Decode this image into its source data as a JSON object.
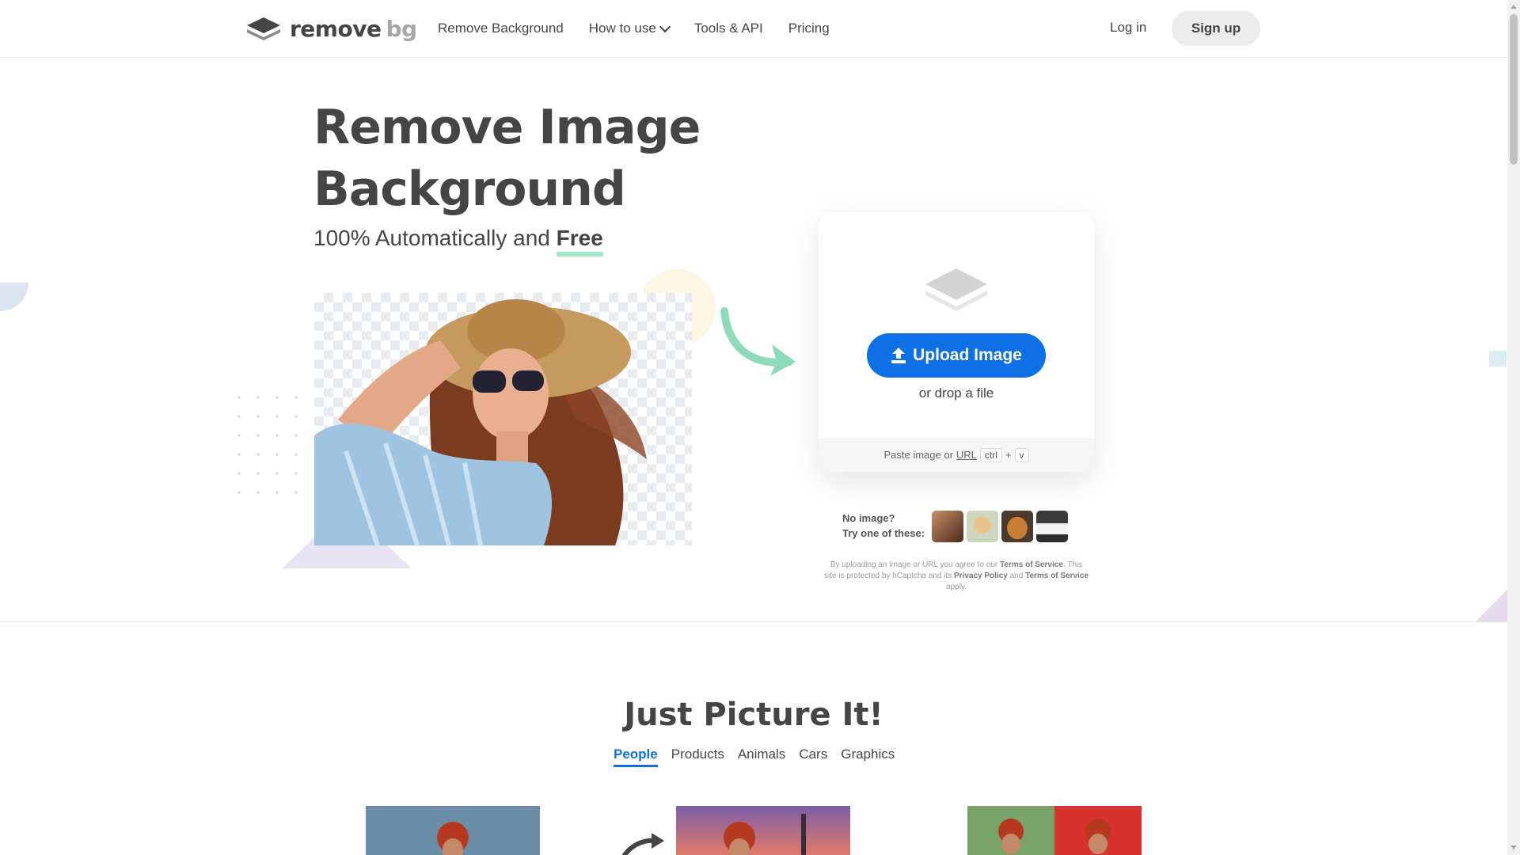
{
  "header": {
    "logo_main": "remove",
    "logo_suffix": "bg",
    "nav": [
      {
        "label": "Remove Background",
        "icon": null
      },
      {
        "label": "How to use",
        "icon": "chevron-down-icon"
      },
      {
        "label": "Tools & API",
        "icon": null
      },
      {
        "label": "Pricing",
        "icon": null
      }
    ],
    "login_label": "Log in",
    "signup_label": "Sign up"
  },
  "hero": {
    "title_line1": "Remove Image",
    "title_line2": "Background",
    "subtitle_prefix": "100% Automatically and",
    "subtitle_highlight": "Free"
  },
  "upload": {
    "button_label": "Upload Image",
    "button_icon": "upload-icon",
    "drop_text": "or drop a file",
    "paste_prefix": "Paste image or",
    "paste_link": "URL",
    "key1": "ctrl",
    "key_plus": "+",
    "key2": "v"
  },
  "samples": {
    "line1": "No image?",
    "line2": "Try one of these:",
    "thumbs": [
      "woman-portrait",
      "dog",
      "bread",
      "white-car"
    ]
  },
  "disclaimer": {
    "part1": "By uploading an image or URL you agree to our",
    "tos1": "Terms of Service",
    "part2": ". This site is protected by hCaptcha and its",
    "privacy": "Privacy Policy",
    "part3": "and",
    "tos2": "Terms of Service",
    "part4": "apply."
  },
  "section2": {
    "title": "Just Picture It!",
    "tabs": [
      "People",
      "Products",
      "Animals",
      "Cars",
      "Graphics"
    ],
    "active_tab": "People"
  },
  "colors": {
    "brand_blue": "#0f70e6",
    "text_dark": "#454545",
    "accent_green": "#a7e5c8"
  }
}
